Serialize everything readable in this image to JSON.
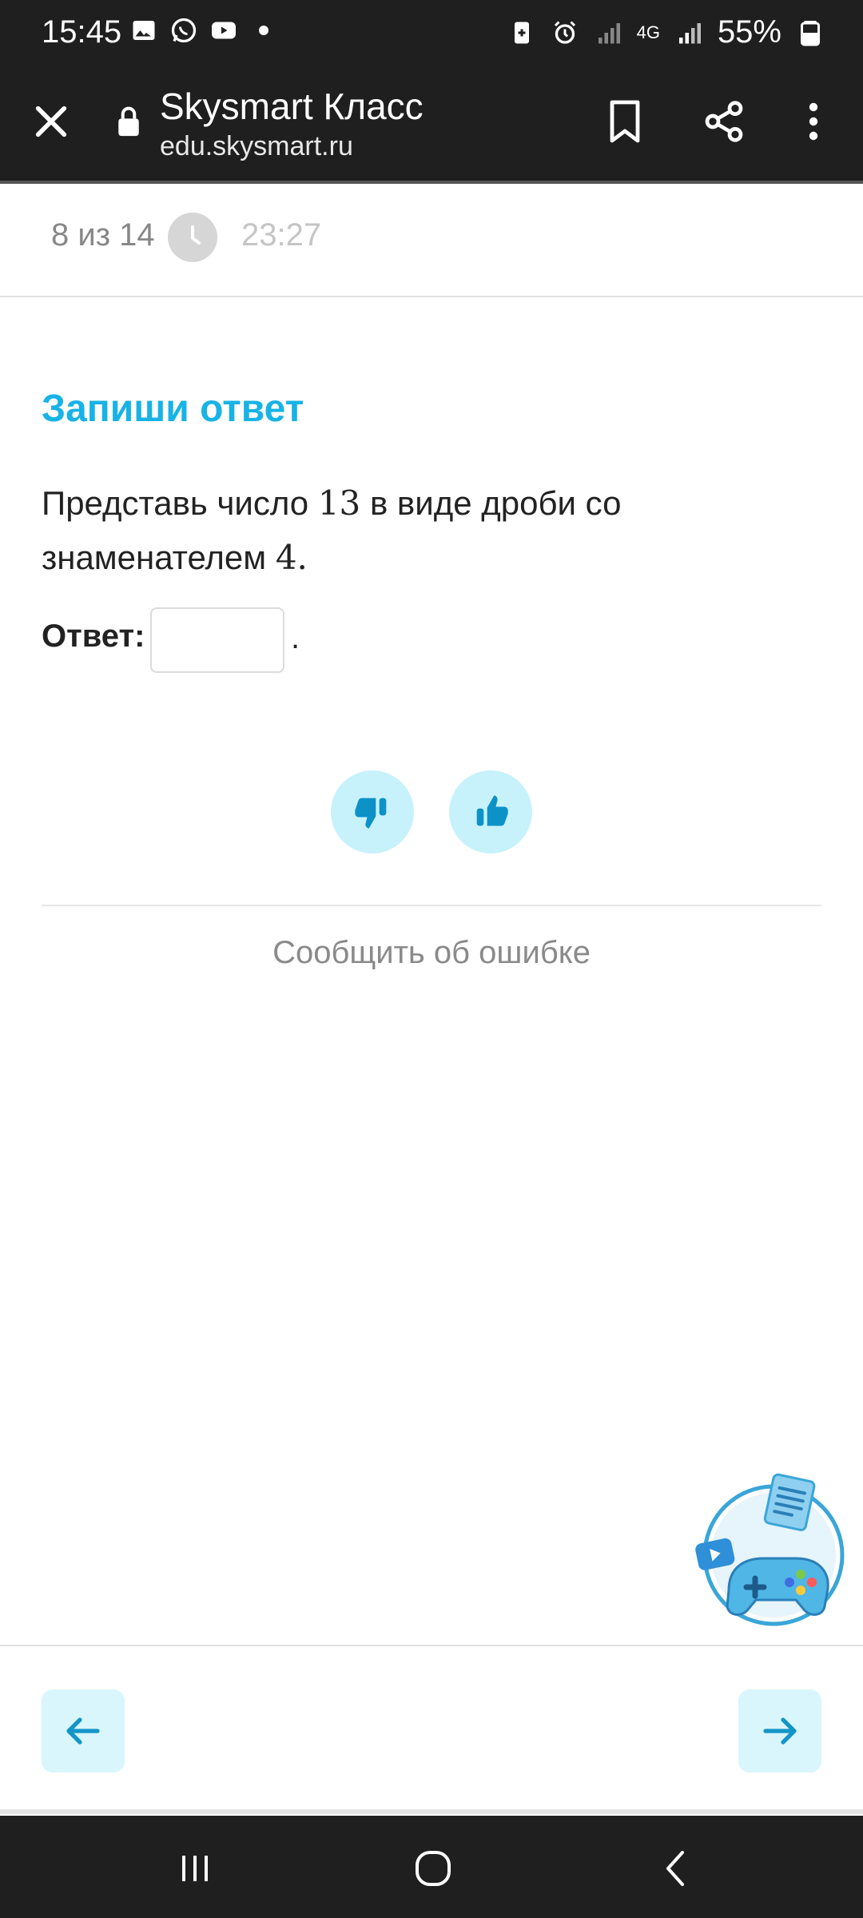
{
  "status_bar": {
    "time": "15:45",
    "battery_percent": "55%",
    "network": "4G",
    "icons_left": [
      "gallery-icon",
      "whatsapp-icon",
      "youtube-icon",
      "dot-icon"
    ],
    "icons_right": [
      "battery-saver-icon",
      "alarm-icon",
      "signal-icon",
      "signal-icon",
      "battery-icon"
    ]
  },
  "browser": {
    "title": "Skysmart Класс",
    "url": "edu.skysmart.ru"
  },
  "progress": {
    "label": "8 из 14",
    "timer": "23:27"
  },
  "task": {
    "heading": "Запиши ответ",
    "text_part1": "Представь число ",
    "number1": "13",
    "text_part2": " в виде дроби со знаменателем ",
    "number2": "4",
    "text_part3": ".",
    "answer_label": "Ответ:",
    "answer_value": "",
    "answer_suffix": "."
  },
  "feedback": {
    "report_label": "Сообщить об ошибке"
  },
  "colors": {
    "accent": "#18b3e6",
    "button_bg": "#c8f2fb",
    "nav_bg": "#d9f6fc",
    "dark_bar": "#1f1f1f"
  }
}
